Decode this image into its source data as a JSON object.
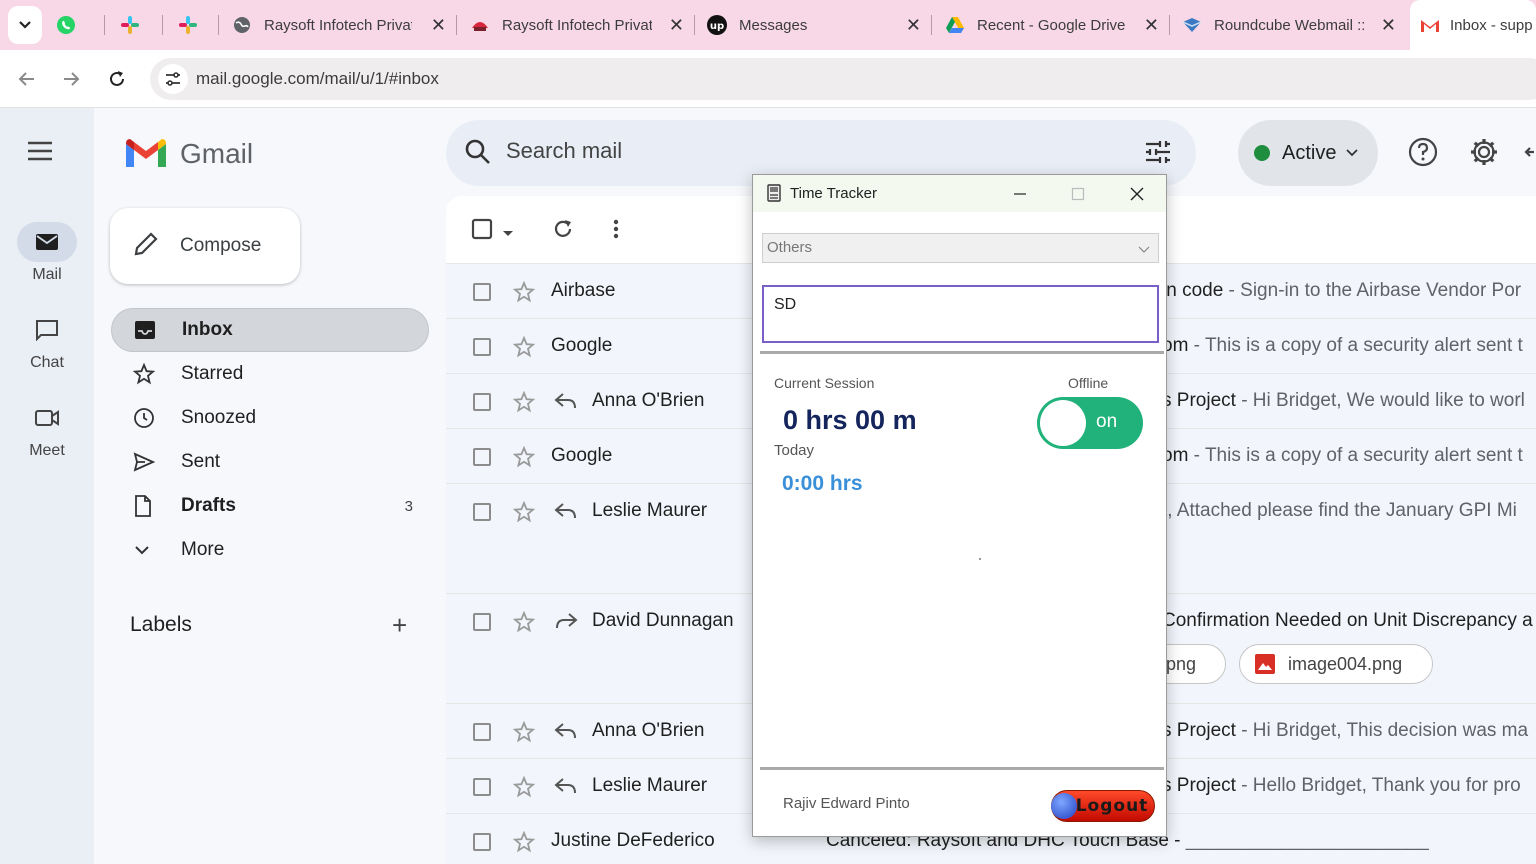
{
  "browser": {
    "tabs": [
      {
        "title": "",
        "icon": "whatsapp-icon"
      },
      {
        "title": "",
        "icon": "slack-icon"
      },
      {
        "title": "",
        "icon": "slack-icon"
      },
      {
        "title": "Raysoft Infotech Privat",
        "icon": "globe-icon"
      },
      {
        "title": "Raysoft Infotech Privat",
        "icon": "raysoft-icon"
      },
      {
        "title": "Messages",
        "icon": "upwork-icon"
      },
      {
        "title": "Recent - Google Drive",
        "icon": "google-drive-icon"
      },
      {
        "title": "Roundcube Webmail ::",
        "icon": "roundcube-icon"
      },
      {
        "title": "Inbox - supp",
        "icon": "gmail-icon"
      }
    ],
    "url": "mail.google.com/mail/u/1/#inbox"
  },
  "rail": {
    "mail": "Mail",
    "chat": "Chat",
    "meet": "Meet"
  },
  "gmail": {
    "logo_text": "Gmail",
    "compose": "Compose",
    "nav": [
      {
        "label": "Inbox",
        "count": ""
      },
      {
        "label": "Starred",
        "count": ""
      },
      {
        "label": "Snoozed",
        "count": ""
      },
      {
        "label": "Sent",
        "count": ""
      },
      {
        "label": "Drafts",
        "count": "3"
      },
      {
        "label": "More",
        "count": ""
      }
    ],
    "labels_heading": "Labels",
    "search_placeholder": "Search mail",
    "status": "Active"
  },
  "emails": [
    {
      "sender": "Airbase",
      "subject": "in code",
      "snippet": " - Sign-in to the Airbase Vendor Por"
    },
    {
      "sender": "Google",
      "subject": "om",
      "snippet": " - This is a copy of a security alert sent t"
    },
    {
      "sender": "Anna O'Brien",
      "subject": "s Project",
      "snippet": " - Hi Bridget, We would like to worl"
    },
    {
      "sender": "Google",
      "subject": "om",
      "snippet": " - This is a copy of a security alert sent t"
    },
    {
      "sender": "Leslie Maurer",
      "subject": "",
      "snippet": "t, Attached please find the January GPI Mi"
    },
    {
      "sender": "David Dunnagan",
      "subject": "Confirmation Needed on Unit Discrepancy a",
      "snippet": "",
      "attachments": [
        "3.png",
        "image004.png"
      ]
    },
    {
      "sender": "Anna O'Brien",
      "subject": "s Project",
      "snippet": " - Hi Bridget, This decision was ma"
    },
    {
      "sender": "Leslie Maurer",
      "subject": "s Project",
      "snippet": " - Hello Bridget, Thank you for pro"
    },
    {
      "sender": "Justine DeFederico",
      "subject": "Canceled: Raysoft and DHC Touch Base -",
      "snippet": " _______________________"
    }
  ],
  "time_tracker": {
    "title": "Time Tracker",
    "category": "Others",
    "task_text": "SD",
    "current_session_label": "Current Session",
    "offline_label": "Offline",
    "session_time": "0 hrs 00 m",
    "today_label": "Today",
    "today_time": "0:00 hrs",
    "toggle_label": "on",
    "toggle_on": true,
    "user_name": "Rajiv Edward Pinto",
    "logout_label": "Logout"
  },
  "colors": {
    "tabstrip": "#f8d8e6",
    "toggle_on": "#20b27a",
    "session_time": "#14245c",
    "today_time": "#3a8fd9",
    "logout": "#e0200a",
    "active_status": "#1e8e3e"
  }
}
